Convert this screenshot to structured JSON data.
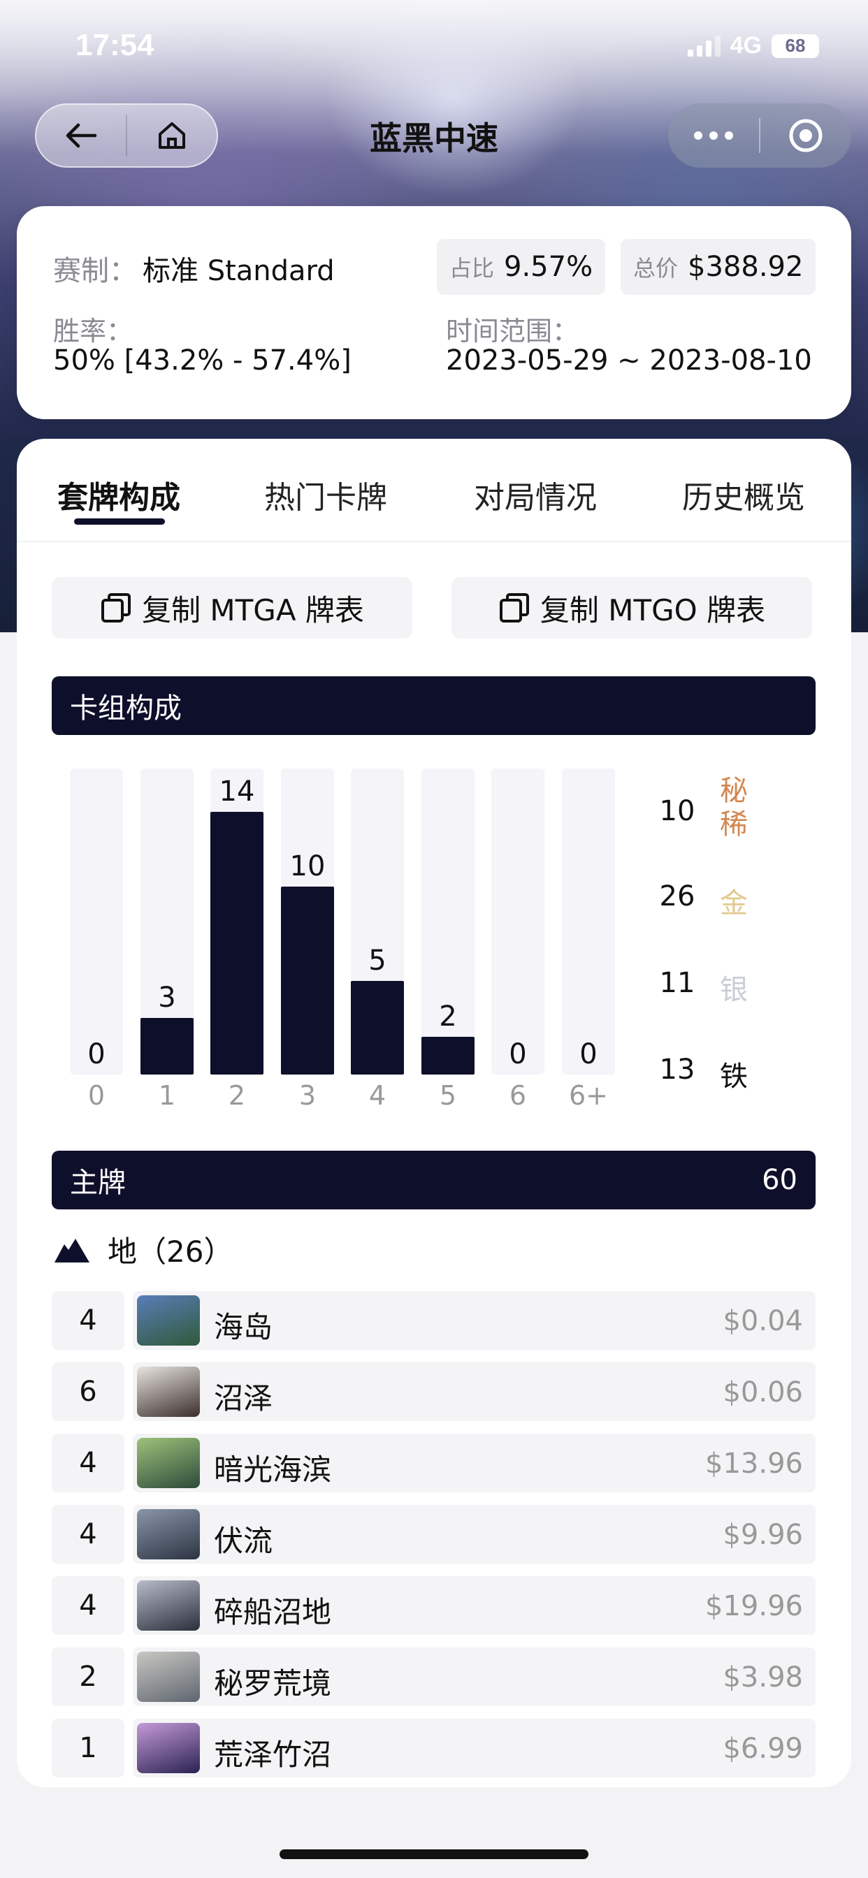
{
  "status": {
    "time": "17:54",
    "network": "4G",
    "battery": "68"
  },
  "header": {
    "title": "蓝黑中速"
  },
  "info": {
    "format_label": "赛制：",
    "format_value": "标准 Standard",
    "share_label": "占比",
    "share_value": "9.57%",
    "price_label": "总价",
    "price_value": "$388.92",
    "winrate_label": "胜率：",
    "winrate_value": "50% [43.2% - 57.4%]",
    "range_label": "时间范围：",
    "range_value": "2023-05-29 ~ 2023-08-10"
  },
  "tabs": [
    {
      "label": "套牌构成",
      "active": true
    },
    {
      "label": "热门卡牌",
      "active": false
    },
    {
      "label": "对局情况",
      "active": false
    },
    {
      "label": "历史概览",
      "active": false
    }
  ],
  "actions": {
    "copy_mtga": "复制 MTGA 牌表",
    "copy_mtgo": "复制 MTGO 牌表"
  },
  "composition": {
    "title": "卡组构成"
  },
  "chart_data": {
    "type": "bar",
    "categories": [
      "0",
      "1",
      "2",
      "3",
      "4",
      "5",
      "6",
      "6+"
    ],
    "values": [
      0,
      3,
      14,
      10,
      5,
      2,
      0,
      0
    ],
    "ylim": [
      0,
      14
    ],
    "grid": false
  },
  "rarity": [
    {
      "count": "10",
      "label": "秘稀",
      "color": "#d2874f"
    },
    {
      "count": "26",
      "label": "金",
      "color": "#e2c98f"
    },
    {
      "count": "11",
      "label": "银",
      "color": "#c8ccd6"
    },
    {
      "count": "13",
      "label": "铁",
      "color": "#111111"
    }
  ],
  "mainboard": {
    "label": "主牌",
    "count": "60"
  },
  "lands": {
    "header": "地（26）",
    "icon": "mountain-icon",
    "cards": [
      {
        "qty": "4",
        "name": "海岛",
        "price": "$0.04",
        "art": [
          "#5a7db8",
          "#2f5a3a"
        ]
      },
      {
        "qty": "6",
        "name": "沼泽",
        "price": "$0.06",
        "art": [
          "#e8e4e0",
          "#3a2e2c"
        ]
      },
      {
        "qty": "4",
        "name": "暗光海滨",
        "price": "$13.96",
        "art": [
          "#9ec27a",
          "#2d4a3a"
        ]
      },
      {
        "qty": "4",
        "name": "伏流",
        "price": "$9.96",
        "art": [
          "#8a95a8",
          "#2c3442"
        ]
      },
      {
        "qty": "4",
        "name": "碎船沼地",
        "price": "$19.96",
        "art": [
          "#b8bcc8",
          "#2a2e3a"
        ]
      },
      {
        "qty": "2",
        "name": "秘罗荒境",
        "price": "$3.98",
        "art": [
          "#c9c7c2",
          "#5f6670"
        ]
      },
      {
        "qty": "1",
        "name": "荒泽竹沼",
        "price": "$6.99",
        "art": [
          "#c49ad8",
          "#2a2350"
        ]
      }
    ]
  }
}
